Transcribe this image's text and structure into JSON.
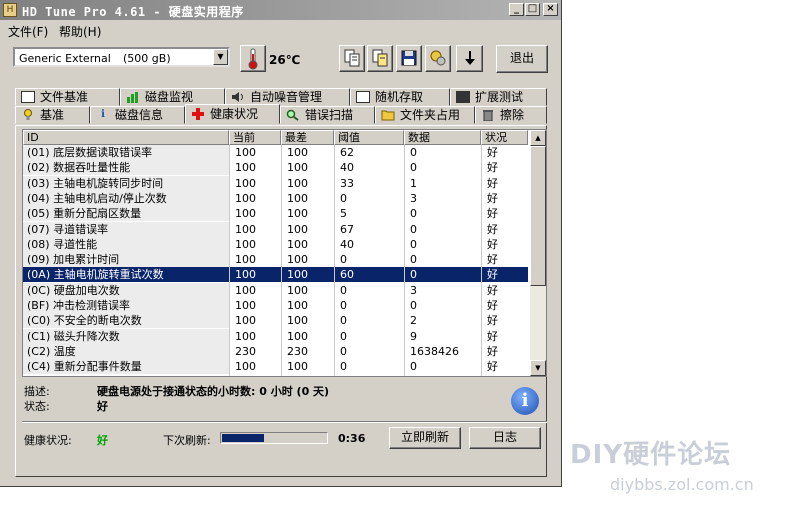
{
  "window": {
    "title": "HD Tune Pro 4.61 - 硬盘实用程序"
  },
  "menu": [
    {
      "label": "文件(F)"
    },
    {
      "label": "帮助(H)"
    }
  ],
  "toolbar": {
    "drive_name": "Generic External",
    "drive_size": "(500 gB)",
    "temperature": "26℃",
    "exit_label": "退出"
  },
  "tabs_row1": [
    {
      "label": "文件基准",
      "icon": "file-benchmark-icon"
    },
    {
      "label": "磁盘监视",
      "icon": "disk-monitor-icon"
    },
    {
      "label": "自动噪音管理",
      "icon": "speaker-icon"
    },
    {
      "label": "随机存取",
      "icon": "random-access-icon"
    },
    {
      "label": "扩展测试",
      "icon": "extra-tests-icon"
    }
  ],
  "tabs_row2": [
    {
      "label": "基准",
      "icon": "benchmark-icon"
    },
    {
      "label": "磁盘信息",
      "icon": "info-icon"
    },
    {
      "label": "健康状况",
      "icon": "health-cross-icon"
    },
    {
      "label": "错误扫描",
      "icon": "magnifier-icon"
    },
    {
      "label": "文件夹占用",
      "icon": "folder-icon"
    },
    {
      "label": "擦除",
      "icon": "trash-icon"
    }
  ],
  "grid": {
    "columns": [
      "ID",
      "当前",
      "最差",
      "阈值",
      "数据",
      "状况"
    ],
    "selected_index": 8,
    "rows": [
      [
        "(01) 底层数据读取错误率",
        "100",
        "100",
        "62",
        "0",
        "好"
      ],
      [
        "(02) 数据吞吐量性能",
        "100",
        "100",
        "40",
        "0",
        "好"
      ],
      [
        "(03) 主轴电机旋转同步时间",
        "100",
        "100",
        "33",
        "1",
        "好"
      ],
      [
        "(04) 主轴电机启动/停止次数",
        "100",
        "100",
        "0",
        "3",
        "好"
      ],
      [
        "(05) 重新分配扇区数量",
        "100",
        "100",
        "5",
        "0",
        "好"
      ],
      [
        "(07) 寻道错误率",
        "100",
        "100",
        "67",
        "0",
        "好"
      ],
      [
        "(08) 寻道性能",
        "100",
        "100",
        "40",
        "0",
        "好"
      ],
      [
        "(09) 加电累计时间",
        "100",
        "100",
        "0",
        "0",
        "好"
      ],
      [
        "(0A) 主轴电机旋转重试次数",
        "100",
        "100",
        "60",
        "0",
        "好"
      ],
      [
        "(0C) 硬盘加电次数",
        "100",
        "100",
        "0",
        "3",
        "好"
      ],
      [
        "(BF) 冲击检测错误率",
        "100",
        "100",
        "0",
        "0",
        "好"
      ],
      [
        "(C0) 不安全的断电次数",
        "100",
        "100",
        "0",
        "2",
        "好"
      ],
      [
        "(C1) 磁头升降次数",
        "100",
        "100",
        "0",
        "9",
        "好"
      ],
      [
        "(C2) 温度",
        "230",
        "230",
        "0",
        "1638426",
        "好"
      ],
      [
        "(C4) 重新分配事件数量",
        "100",
        "100",
        "0",
        "0",
        "好"
      ]
    ]
  },
  "info": {
    "desc_label": "描述:",
    "desc_value": "硬盘电源处于接通状态的小时数: 0 小时 (0 天)",
    "status_label": "状态:",
    "status_value": "好"
  },
  "footer": {
    "health_label": "健康状况:",
    "health_value": "好",
    "health_color": "#00a000",
    "refresh_label": "下次刷新:",
    "refresh_progress": 0.4,
    "refresh_time": "0:36",
    "refresh_now_label": "立即刷新",
    "log_label": "日志"
  },
  "watermark": {
    "line1": "DIY硬件论坛",
    "line2": "diybbs.zol.com.cn"
  }
}
